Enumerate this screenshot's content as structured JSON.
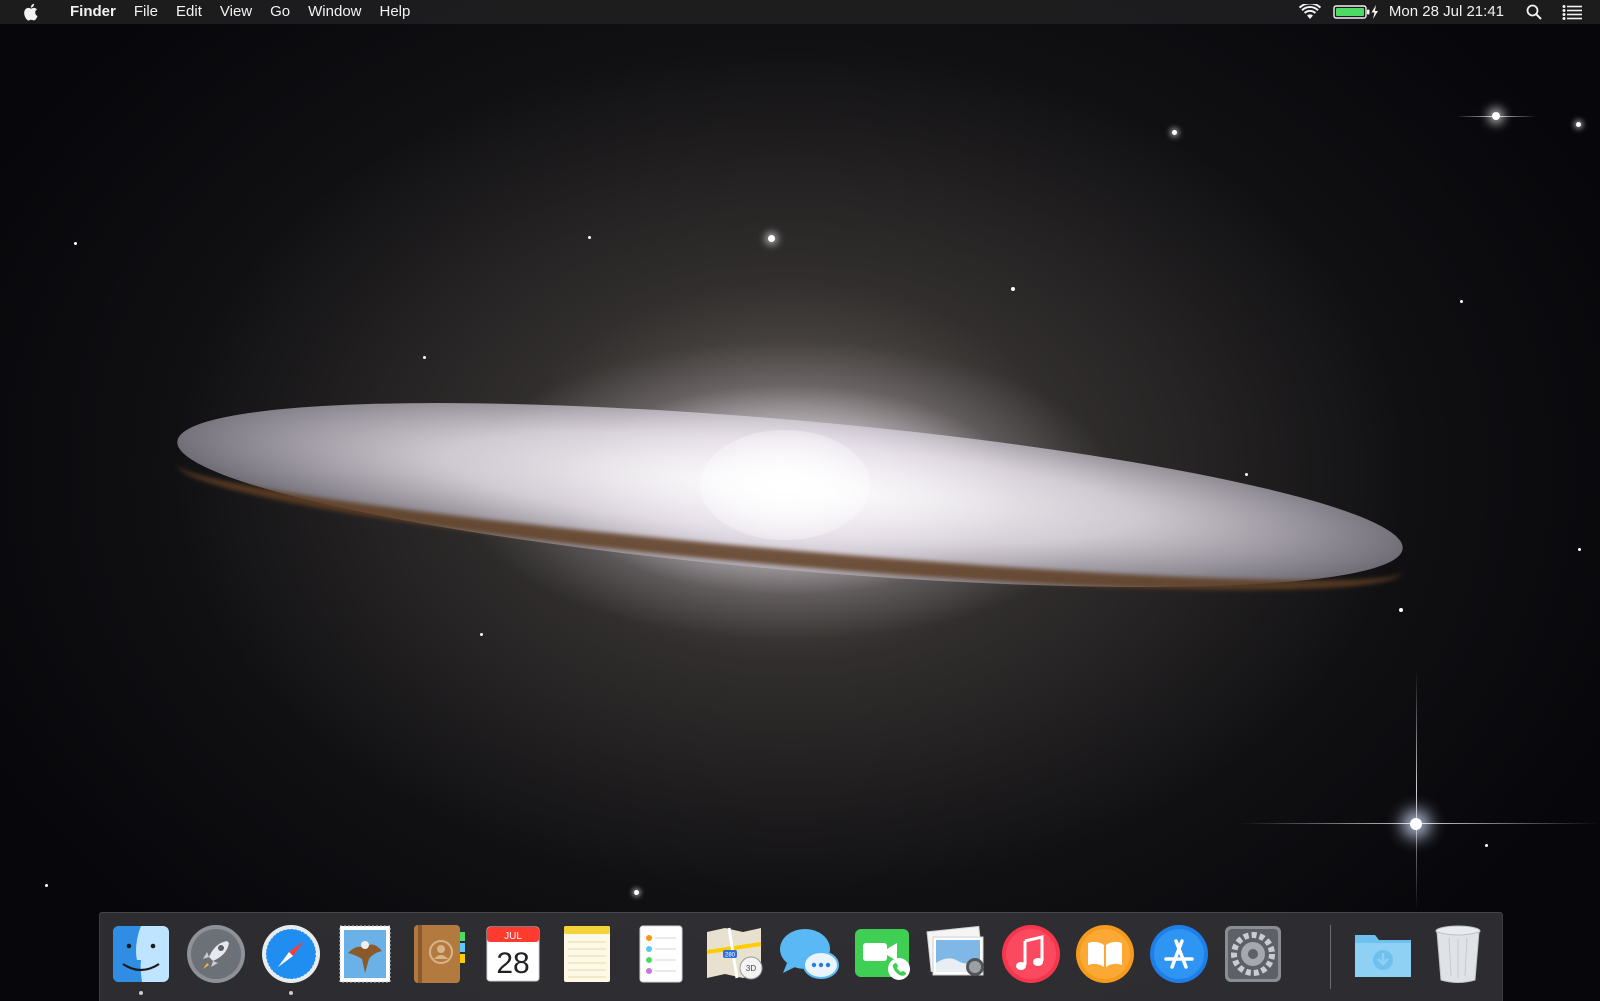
{
  "menubar": {
    "apple_icon": "apple-logo",
    "app_name": "Finder",
    "menus": [
      "File",
      "Edit",
      "View",
      "Go",
      "Window",
      "Help"
    ],
    "status": {
      "wifi_icon": "wifi-icon",
      "battery_icon": "battery-charging-icon",
      "clock": "Mon 28 Jul  21:41",
      "spotlight_icon": "search-icon",
      "notification_icon": "list-icon"
    }
  },
  "desktop": {
    "wallpaper": "sombrero-galaxy"
  },
  "dock": {
    "apps": [
      {
        "name": "Finder",
        "icon": "finder-icon",
        "running": true
      },
      {
        "name": "Launchpad",
        "icon": "rocket-icon",
        "running": false
      },
      {
        "name": "Safari",
        "icon": "compass-icon",
        "running": true
      },
      {
        "name": "Mail",
        "icon": "stamp-icon",
        "running": false
      },
      {
        "name": "Contacts",
        "icon": "address-book-icon",
        "running": false
      },
      {
        "name": "Calendar",
        "icon": "calendar-icon",
        "running": false,
        "month": "JUL",
        "day": "28"
      },
      {
        "name": "Notes",
        "icon": "notepad-icon",
        "running": false
      },
      {
        "name": "Reminders",
        "icon": "checklist-icon",
        "running": false
      },
      {
        "name": "Maps",
        "icon": "map-icon",
        "running": false,
        "road_label": "280",
        "view_label": "3D"
      },
      {
        "name": "Messages",
        "icon": "chat-bubble-icon",
        "running": false
      },
      {
        "name": "FaceTime",
        "icon": "video-camera-icon",
        "running": false
      },
      {
        "name": "iPhoto",
        "icon": "photos-icon",
        "running": false
      },
      {
        "name": "iTunes",
        "icon": "music-note-icon",
        "running": false
      },
      {
        "name": "iBooks",
        "icon": "book-icon",
        "running": false
      },
      {
        "name": "App Store",
        "icon": "app-store-icon",
        "running": false
      },
      {
        "name": "System Preferences",
        "icon": "gear-icon",
        "running": false
      }
    ],
    "extras": [
      {
        "name": "Downloads",
        "icon": "downloads-folder-icon"
      },
      {
        "name": "Trash",
        "icon": "trash-icon"
      }
    ]
  },
  "colors": {
    "menubar_bg": "#1e1e20",
    "dock_bg": "#3c3c40",
    "battery_green": "#4cd964"
  }
}
